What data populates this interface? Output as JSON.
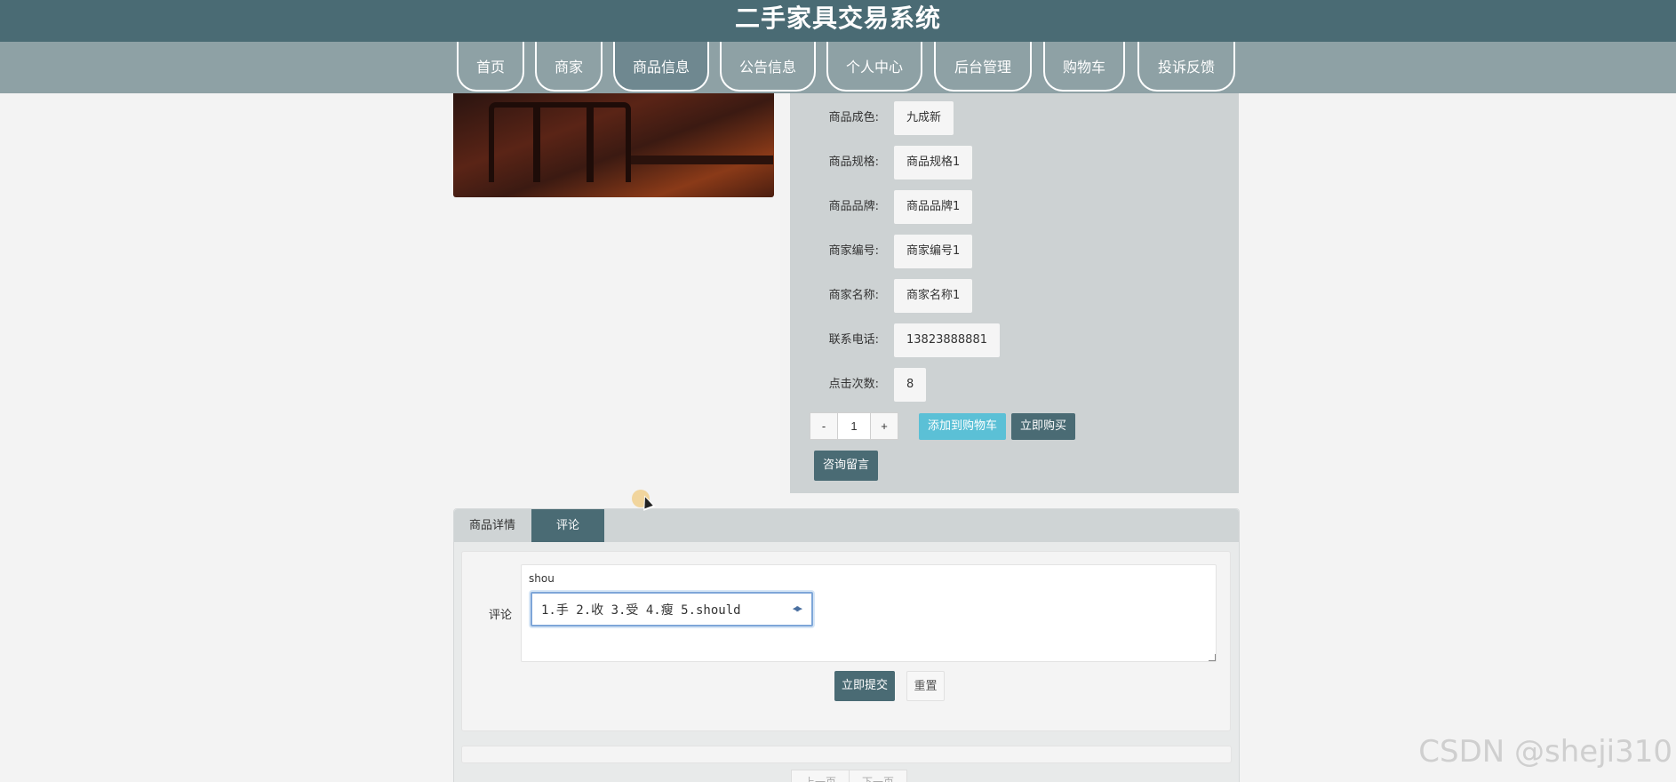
{
  "site": {
    "title": "二手家具交易系统"
  },
  "nav": {
    "items": [
      {
        "label": "首页",
        "active": false
      },
      {
        "label": "商家",
        "active": false
      },
      {
        "label": "商品信息",
        "active": true
      },
      {
        "label": "公告信息",
        "active": false
      },
      {
        "label": "个人中心",
        "active": false
      },
      {
        "label": "后台管理",
        "active": false
      },
      {
        "label": "购物车",
        "active": false
      },
      {
        "label": "投诉反馈",
        "active": false
      }
    ]
  },
  "product": {
    "fields": [
      {
        "label": "商品成色:",
        "value": "九成新"
      },
      {
        "label": "商品规格:",
        "value": "商品规格1"
      },
      {
        "label": "商品品牌:",
        "value": "商品品牌1"
      },
      {
        "label": "商家编号:",
        "value": "商家编号1"
      },
      {
        "label": "商家名称:",
        "value": "商家名称1"
      },
      {
        "label": "联系电话:",
        "value": "13823888881"
      },
      {
        "label": "点击次数:",
        "value": "8"
      }
    ],
    "quantity": {
      "minus": "-",
      "value": "1",
      "plus": "+"
    },
    "add_to_cart_label": "添加到购物车",
    "buy_now_label": "立即购买",
    "consult_label": "咨询留言"
  },
  "tabs": {
    "items": [
      {
        "label": "商品详情",
        "active": false
      },
      {
        "label": "评论",
        "active": true
      }
    ]
  },
  "comment": {
    "label": "评论",
    "input_value": "shou",
    "ime_candidates": "1.手 2.收 3.受 4.瘦 5.should",
    "submit_label": "立即提交",
    "reset_label": "重置"
  },
  "pager": {
    "prev": "上一页",
    "next": "下一页"
  },
  "watermark": "CSDN @sheji310",
  "colors": {
    "header": "#4a6b74",
    "nav": "#8ea1a5",
    "accent": "#5bc0d6"
  }
}
